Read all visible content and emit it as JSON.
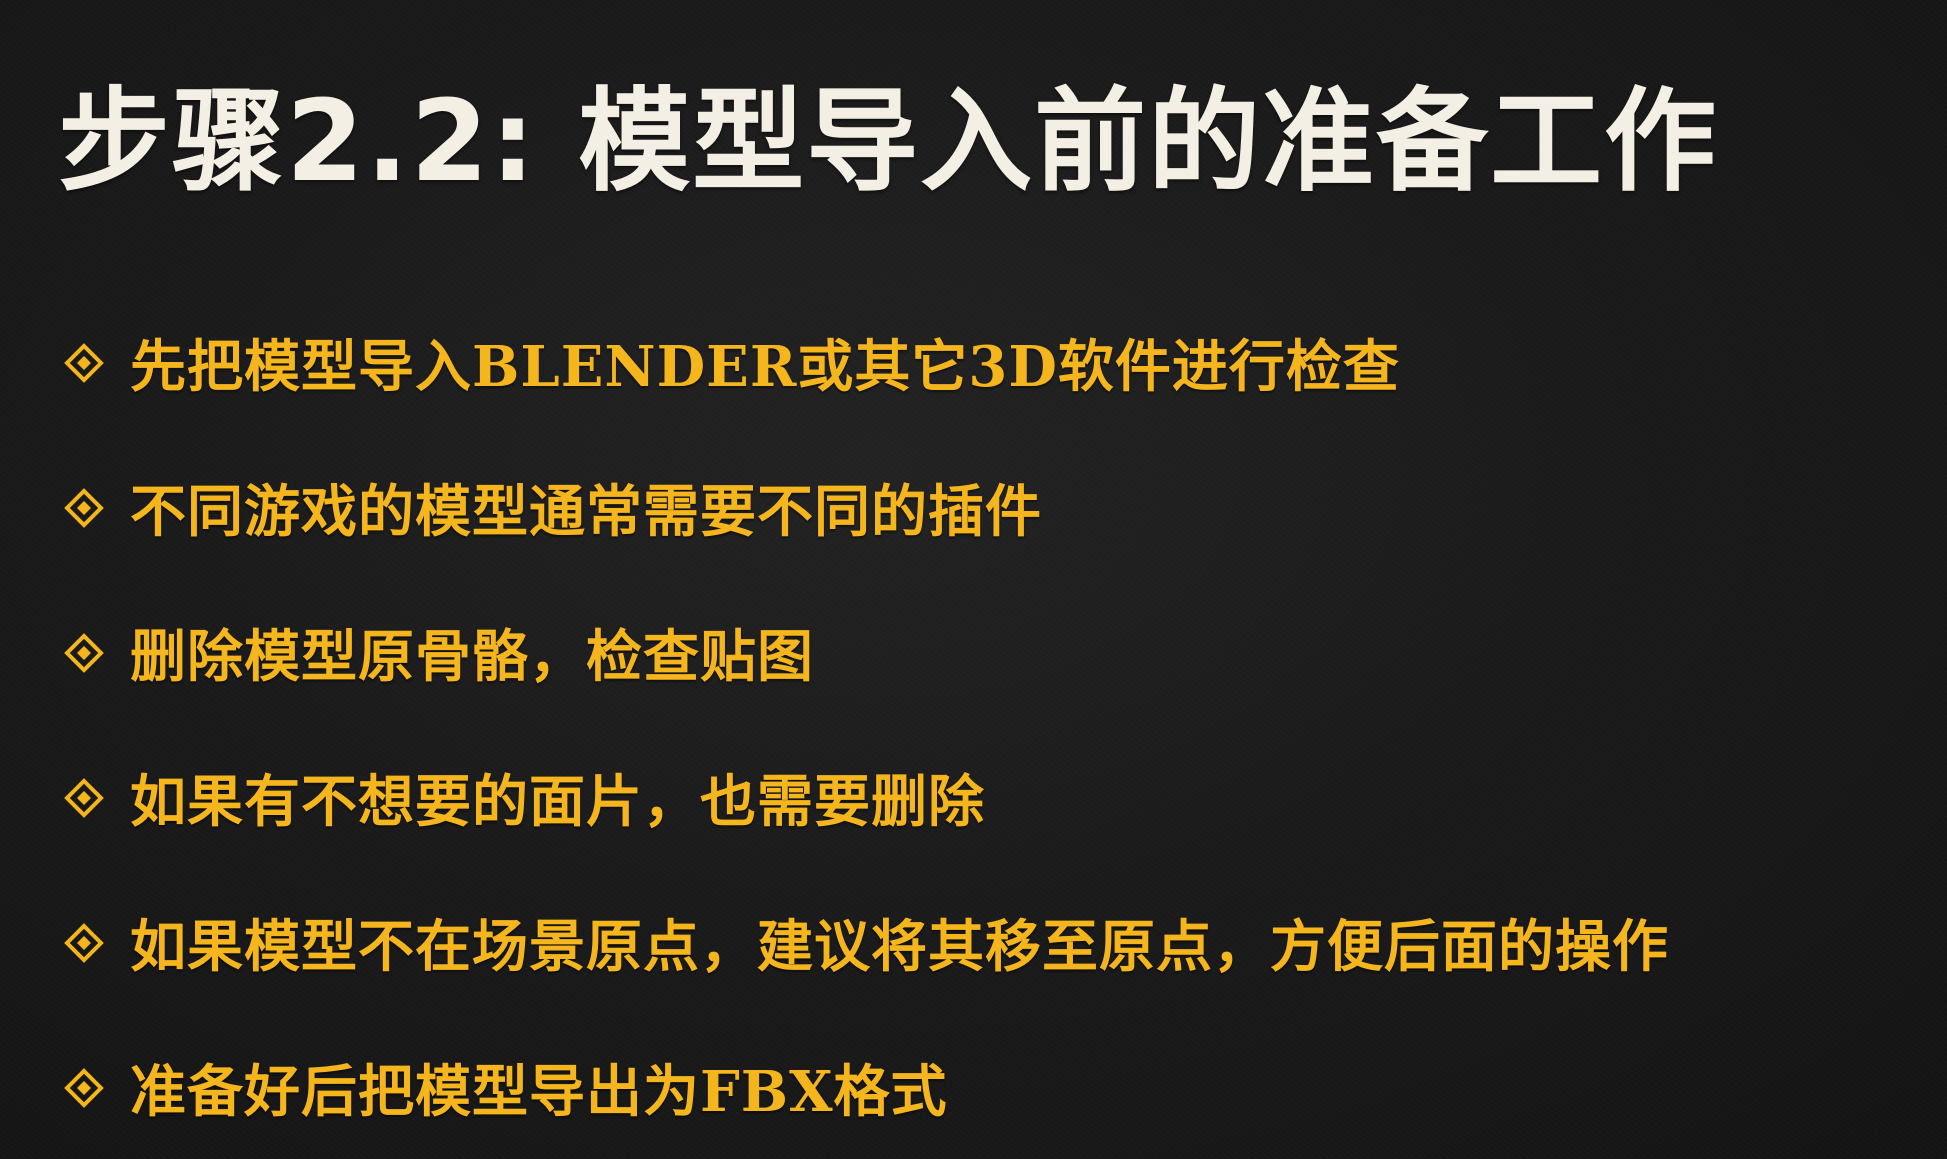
{
  "slide": {
    "title": "步骤2.2: 模型导入前的准备工作",
    "bullet_icon": "diamond-bullet-icon",
    "colors": {
      "background": "#1b1b1b",
      "title": "#f4efe4",
      "bullet_text": "#f5b51d"
    },
    "bullets": [
      "先把模型导入BLENDER或其它3D软件进行检查",
      "不同游戏的模型通常需要不同的插件",
      "删除模型原骨骼，检查贴图",
      "如果有不想要的面片，也需要删除",
      "如果模型不在场景原点，建议将其移至原点，方便后面的操作",
      "准备好后把模型导出为FBX格式"
    ]
  }
}
